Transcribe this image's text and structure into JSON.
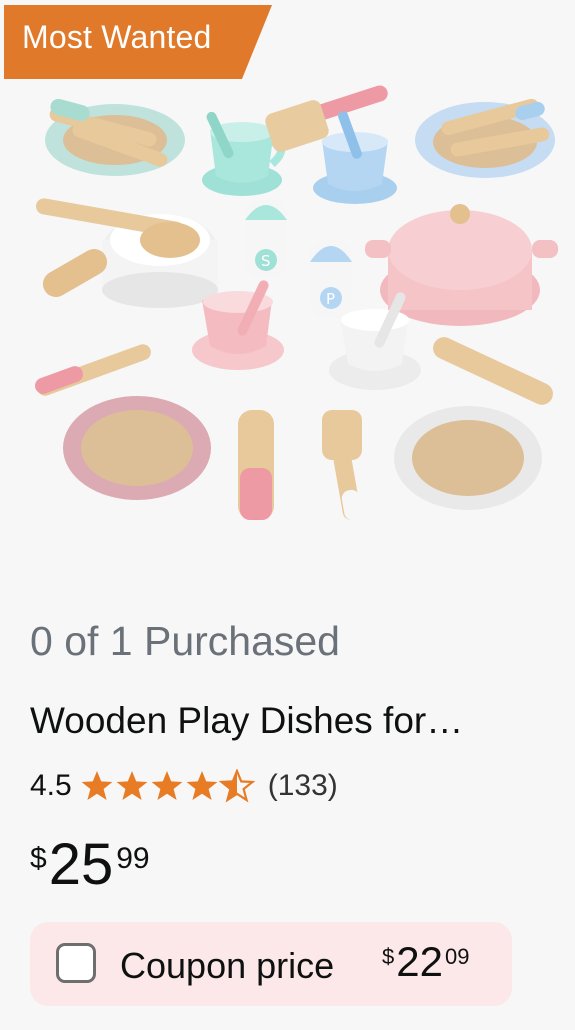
{
  "badge": {
    "label": "Most Wanted",
    "color": "#e07a2a"
  },
  "product": {
    "image_alt_icon": "toy-dishes-set",
    "purchased_text": "0 of 1 Purchased",
    "title": "Wooden Play Dishes for…",
    "rating": "4.5",
    "rating_value": 4.5,
    "review_count": "(133)",
    "star_color": "#e77c25",
    "price": {
      "symbol": "$",
      "whole": "25",
      "fraction": "99"
    }
  },
  "coupon": {
    "label": "Coupon price",
    "checked": false,
    "price": {
      "symbol": "$",
      "whole": "22",
      "fraction": "09"
    },
    "background": "#fce8e9"
  }
}
